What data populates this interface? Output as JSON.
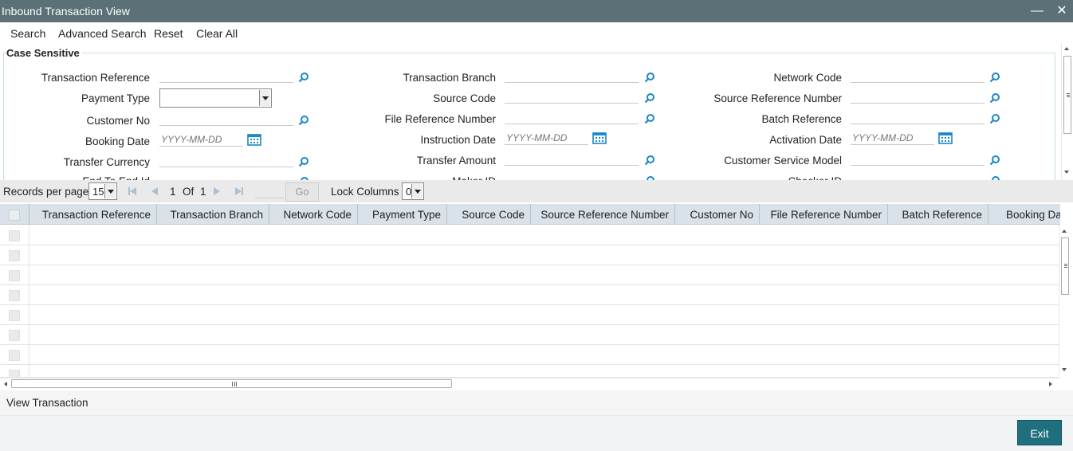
{
  "window": {
    "title": "Inbound Transaction View",
    "minimize_glyph": "—",
    "close_glyph": "✕"
  },
  "menu": {
    "search": "Search",
    "advanced_search": "Advanced Search",
    "reset": "Reset",
    "clear_all": "Clear All"
  },
  "search_panel": {
    "legend": "Case Sensitive",
    "date_placeholder": "YYYY-MM-DD",
    "fields": {
      "transaction_reference": "Transaction Reference",
      "payment_type": "Payment Type",
      "customer_no": "Customer No",
      "booking_date": "Booking Date",
      "transfer_currency": "Transfer Currency",
      "end_to_end_id": "End To End Id",
      "transaction_branch": "Transaction Branch",
      "source_code": "Source Code",
      "file_reference_number": "File Reference Number",
      "instruction_date": "Instruction Date",
      "transfer_amount": "Transfer Amount",
      "maker_id": "Maker ID",
      "network_code": "Network Code",
      "source_reference_number": "Source Reference Number",
      "batch_reference": "Batch Reference",
      "activation_date": "Activation Date",
      "customer_service_model": "Customer Service Model",
      "checker_id": "Checker ID"
    },
    "payment_type_value": ""
  },
  "pager": {
    "records_per_page_label": "Records per page",
    "records_per_page_value": "15",
    "current_page": "1",
    "of_label": "Of",
    "total_pages": "1",
    "go_label": "Go",
    "lock_columns_label": "Lock Columns",
    "lock_columns_value": "0"
  },
  "grid": {
    "columns": [
      "Transaction Reference",
      "Transaction Branch",
      "Network Code",
      "Payment Type",
      "Source Code",
      "Source Reference Number",
      "Customer No",
      "File Reference Number",
      "Batch Reference",
      "Booking Date"
    ],
    "row_count": 8
  },
  "footer": {
    "view_transaction": "View Transaction",
    "exit": "Exit"
  },
  "colors": {
    "titlebar": "#5b7177",
    "grid_header": "#d8e2e8",
    "exit_button": "#1f6f7e",
    "lov_icon": "#1b87c8"
  },
  "icons": {
    "lov": "search-lookup-icon",
    "calendar": "calendar-icon"
  }
}
